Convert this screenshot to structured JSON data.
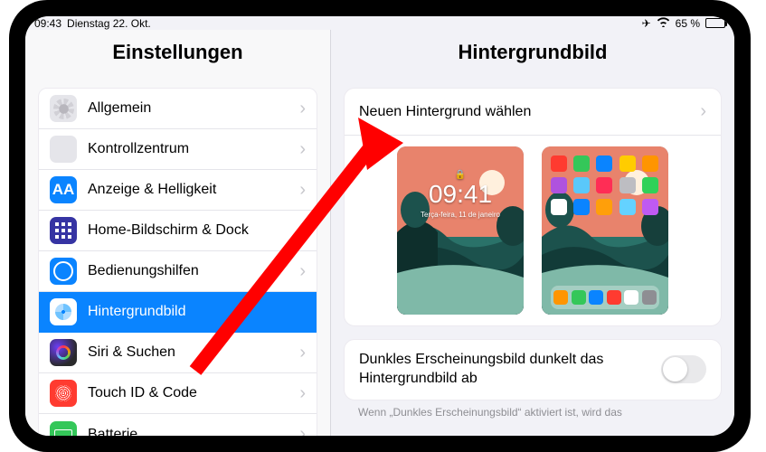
{
  "statusbar": {
    "time": "09:43",
    "date": "Dienstag 22. Okt.",
    "battery_pct": "65 %"
  },
  "sidebar": {
    "title": "Einstellungen",
    "items": [
      {
        "label": "Allgemein"
      },
      {
        "label": "Kontrollzentrum"
      },
      {
        "label": "Anzeige & Helligkeit"
      },
      {
        "label": "Home-Bildschirm & Dock"
      },
      {
        "label": "Bedienungshilfen"
      },
      {
        "label": "Hintergrundbild"
      },
      {
        "label": "Siri & Suchen"
      },
      {
        "label": "Touch ID & Code"
      },
      {
        "label": "Batterie"
      }
    ]
  },
  "detail": {
    "title": "Hintergrundbild",
    "choose_label": "Neuen Hintergrund wählen",
    "lock_clock": "09:41",
    "lock_date": "Terça-feira, 11 de janeiro",
    "dark_dim_label": "Dunkles Erscheinungsbild dunkelt das Hintergrundbild ab",
    "dark_dim_footer": "Wenn „Dunkles Erscheinungsbild“ aktiviert ist, wird das"
  },
  "home_apps": [
    "#ff3b30",
    "#34c759",
    "#0a84ff",
    "#ffcc00",
    "#ff9500",
    "#af52de",
    "#5ac8fa",
    "#ff2d55",
    "#bdbdc2",
    "#30d158",
    "#ffffff",
    "#0a84ff",
    "#ff9f0a",
    "#64d2ff",
    "#bf5af2"
  ],
  "dock_apps": [
    "#ff9500",
    "#34c759",
    "#0a84ff",
    "#ff3b30",
    "#ffffff",
    "#8e8e93"
  ]
}
